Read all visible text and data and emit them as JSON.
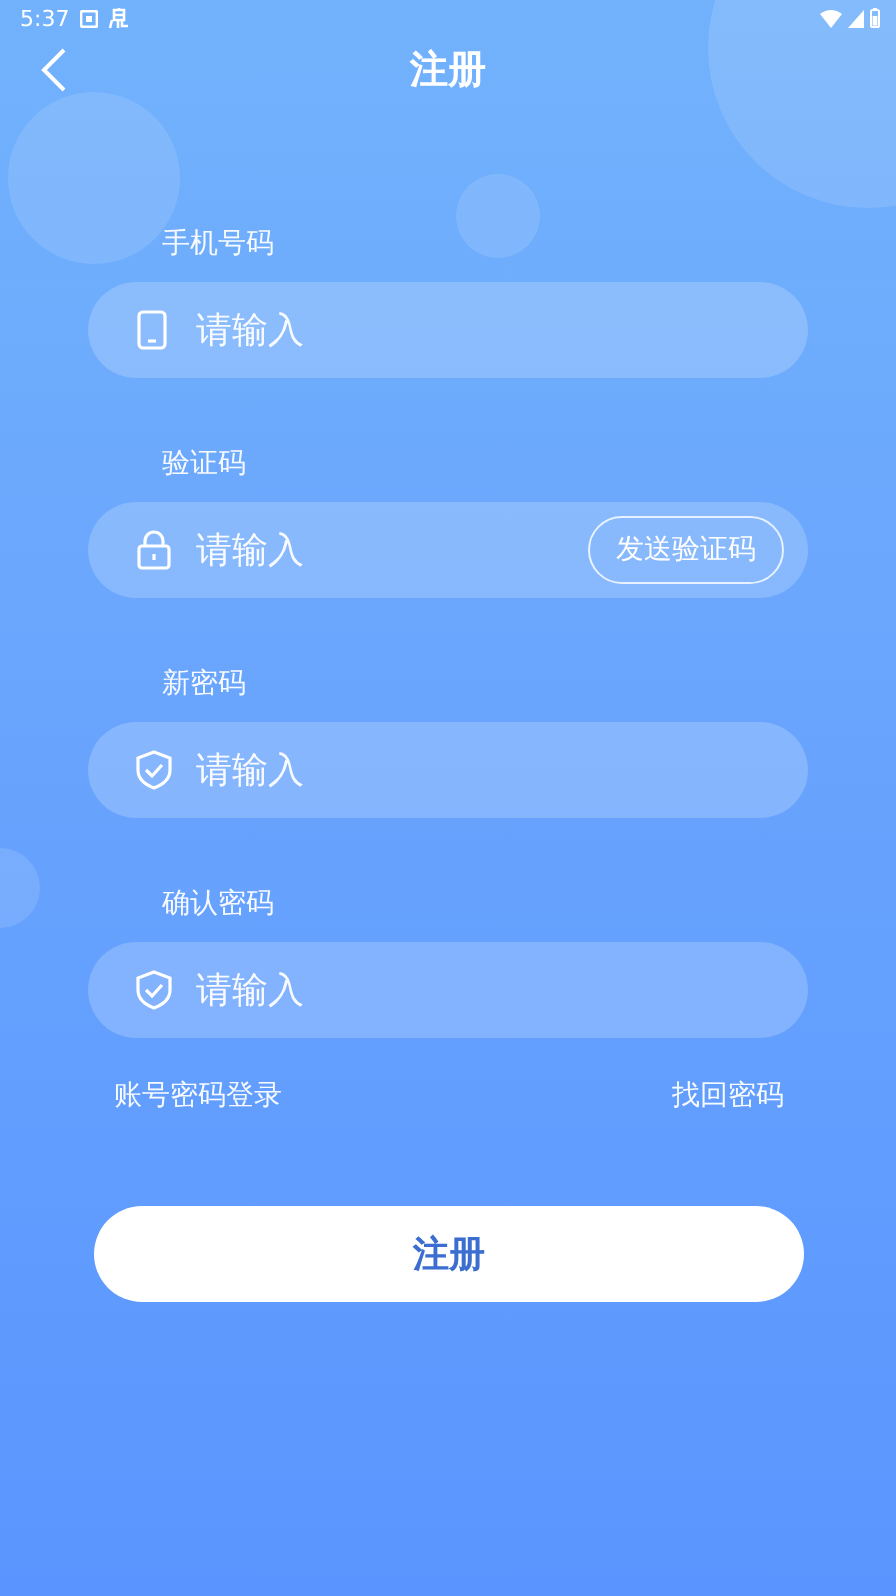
{
  "status_bar": {
    "time": "5:37"
  },
  "header": {
    "title": "注册"
  },
  "fields": [
    {
      "label": "手机号码",
      "kind": "phone",
      "placeholder": "请输入"
    },
    {
      "label": "验证码",
      "kind": "lock",
      "placeholder": "请输入",
      "action": "发送验证码"
    },
    {
      "label": "新密码",
      "kind": "shield",
      "placeholder": "请输入"
    },
    {
      "label": "确认密码",
      "kind": "shield",
      "placeholder": "请输入"
    }
  ],
  "links": [
    "账号密码登录",
    "找回密码"
  ],
  "submit": "注册"
}
